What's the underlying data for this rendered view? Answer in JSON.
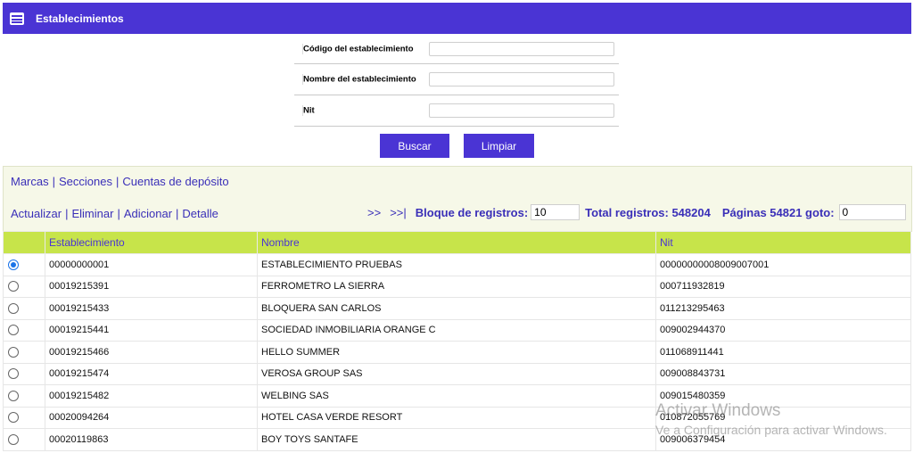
{
  "title": "Establecimientos",
  "form": {
    "codigo_label": "Código del establecimiento",
    "nombre_label": "Nombre del establecimiento",
    "nit_label": "Nit",
    "codigo_value": "",
    "nombre_value": "",
    "nit_value": ""
  },
  "buttons": {
    "buscar": "Buscar",
    "limpiar": "Limpiar"
  },
  "links_top": [
    "Marcas",
    "Secciones",
    "Cuentas de depósito"
  ],
  "links_bottom": [
    "Actualizar",
    "Eliminar",
    "Adicionar",
    "Detalle"
  ],
  "pager": {
    "next": ">>",
    "last": ">>|",
    "bloque_label": "Bloque de registros:",
    "bloque_value": "10",
    "total_label": "Total registros: 548204",
    "paginas_label": "Páginas 54821 goto:",
    "goto_value": "0"
  },
  "table": {
    "headers": [
      "Establecimiento",
      "Nombre",
      "Nit"
    ],
    "rows": [
      {
        "establecimiento": "00000000001",
        "nombre": "ESTABLECIMIENTO PRUEBAS",
        "nit": "00000000008009007001",
        "selected": true
      },
      {
        "establecimiento": "00019215391",
        "nombre": "FERROMETRO LA SIERRA",
        "nit": "000711932819",
        "selected": false
      },
      {
        "establecimiento": "00019215433",
        "nombre": "BLOQUERA SAN CARLOS",
        "nit": "011213295463",
        "selected": false
      },
      {
        "establecimiento": "00019215441",
        "nombre": "SOCIEDAD INMOBILIARIA ORANGE C",
        "nit": "009002944370",
        "selected": false
      },
      {
        "establecimiento": "00019215466",
        "nombre": "HELLO SUMMER",
        "nit": "011068911441",
        "selected": false
      },
      {
        "establecimiento": "00019215474",
        "nombre": "VEROSA GROUP SAS",
        "nit": "009008843731",
        "selected": false
      },
      {
        "establecimiento": "00019215482",
        "nombre": "WELBING SAS",
        "nit": "009015480359",
        "selected": false
      },
      {
        "establecimiento": "00020094264",
        "nombre": "HOTEL CASA VERDE RESORT",
        "nit": "010872055769",
        "selected": false
      },
      {
        "establecimiento": "00020119863",
        "nombre": "BOY TOYS SANTAFE",
        "nit": "009006379454",
        "selected": false
      }
    ]
  },
  "watermark": {
    "line1": "Activar Windows",
    "line2": "Ve a Configuración para activar Windows."
  },
  "colors": {
    "accent": "#4a34d4",
    "header_bg": "#c7e44a",
    "panel_bg": "#f6f8e8"
  }
}
